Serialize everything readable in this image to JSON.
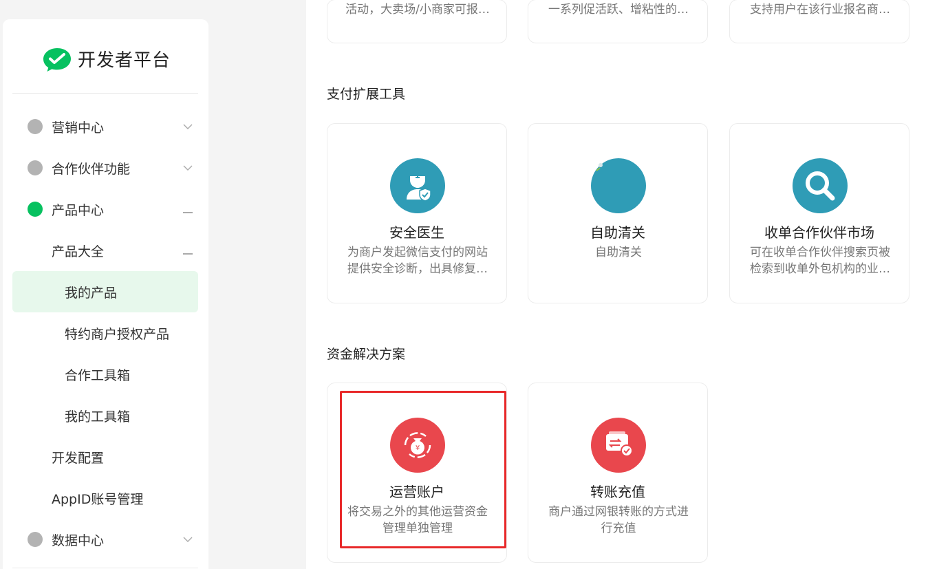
{
  "brand": {
    "name": "开发者平台",
    "color": "#07c160"
  },
  "sidebar": {
    "items": [
      {
        "label": "营销中心"
      },
      {
        "label": "合作伙伴功能"
      },
      {
        "label": "产品中心"
      },
      {
        "label": "产品大全"
      },
      {
        "label": "我的产品"
      },
      {
        "label": "特约商户授权产品"
      },
      {
        "label": "合作工具箱"
      },
      {
        "label": "我的工具箱"
      },
      {
        "label": "开发配置"
      },
      {
        "label": "AppID账号管理"
      },
      {
        "label": "数据中心"
      }
    ]
  },
  "top_cards": [
    {
      "desc": "活动，大卖场/小商家可报…"
    },
    {
      "desc": "一系列促活跃、增粘性的…"
    },
    {
      "desc": "支持用户在该行业报名商…"
    }
  ],
  "sections": [
    {
      "title": "支付扩展工具",
      "cards": [
        {
          "title": "安全医生",
          "desc": "为商户发起微信支付的网站提供安全诊断，出具修复…",
          "icon": "doctor-shield-icon"
        },
        {
          "title": "自助清关",
          "desc": "自助清关",
          "icon": "customs-icon"
        },
        {
          "title": "收单合作伙伴市场",
          "desc": "可在收单合作伙伴搜索页被检索到收单外包机构的业…",
          "icon": "search-icon"
        }
      ]
    },
    {
      "title": "资金解决方案",
      "cards": [
        {
          "title": "运营账户",
          "desc": "将交易之外的其他运营资金管理单独管理",
          "icon": "money-bag-icon"
        },
        {
          "title": "转账充值",
          "desc": "商户通过网银转账的方式进行充值",
          "icon": "transfer-card-icon"
        }
      ]
    }
  ],
  "colors": {
    "teal": "#2f9cb6",
    "red": "#e9474d",
    "active_bg": "#e7f8ec",
    "highlight": "#e8292a"
  }
}
